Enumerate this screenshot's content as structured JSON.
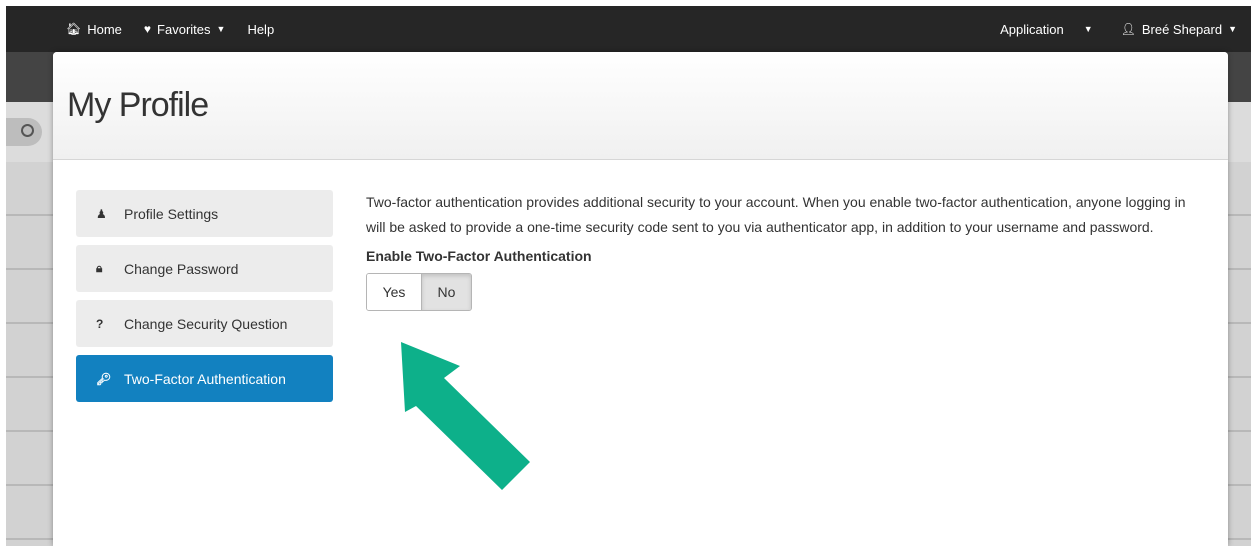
{
  "navbar": {
    "home_label": "Home",
    "favorites_label": "Favorites",
    "help_label": "Help",
    "application_label": "Application",
    "user_name": "Breé Shepard"
  },
  "page": {
    "title": "My Profile"
  },
  "menu": {
    "items": [
      {
        "label": "Profile Settings",
        "icon": "user-icon"
      },
      {
        "label": "Change Password",
        "icon": "lock-icon"
      },
      {
        "label": "Change Security Question",
        "icon": "question-icon"
      },
      {
        "label": "Two-Factor Authentication",
        "icon": "key-icon",
        "active": true
      }
    ]
  },
  "content": {
    "description": "Two-factor authentication provides additional security to your account. When you enable two-factor authentication, anyone logging in will be asked to provide a one-time security code sent to you via authenticator app, in addition to your username and password.",
    "toggle_label": "Enable Two-Factor Authentication",
    "yes_label": "Yes",
    "no_label": "No",
    "selected": "No"
  },
  "colors": {
    "accent": "#1281c0",
    "annotation_arrow": "#0db08a"
  }
}
